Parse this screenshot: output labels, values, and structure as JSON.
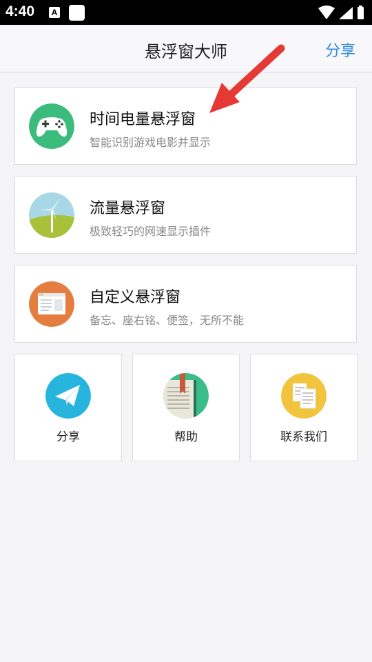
{
  "status_bar": {
    "time": "4:40",
    "notification_letter": "A"
  },
  "app_bar": {
    "title": "悬浮窗大师",
    "share_label": "分享"
  },
  "cards": [
    {
      "title": "时间电量悬浮窗",
      "subtitle": "智能识别游戏电影并显示",
      "icon": "gamepad-icon",
      "icon_color": "#3cbc7c"
    },
    {
      "title": "流量悬浮窗",
      "subtitle": "极致轻巧的网速显示插件",
      "icon": "windmill-icon",
      "icon_color": "#a8d8e6"
    },
    {
      "title": "自定义悬浮窗",
      "subtitle": "备忘、座右铭、便签，无所不能",
      "icon": "browser-window-icon",
      "icon_color": "#e67d40"
    }
  ],
  "tiles": [
    {
      "label": "分享",
      "icon": "paper-plane-icon",
      "icon_color": "#27b5dd"
    },
    {
      "label": "帮助",
      "icon": "book-icon",
      "icon_color": "#3bbd8a"
    },
    {
      "label": "联系我们",
      "icon": "documents-icon",
      "icon_color": "#f2c43d"
    }
  ],
  "annotation_arrow_color": "#e53935"
}
